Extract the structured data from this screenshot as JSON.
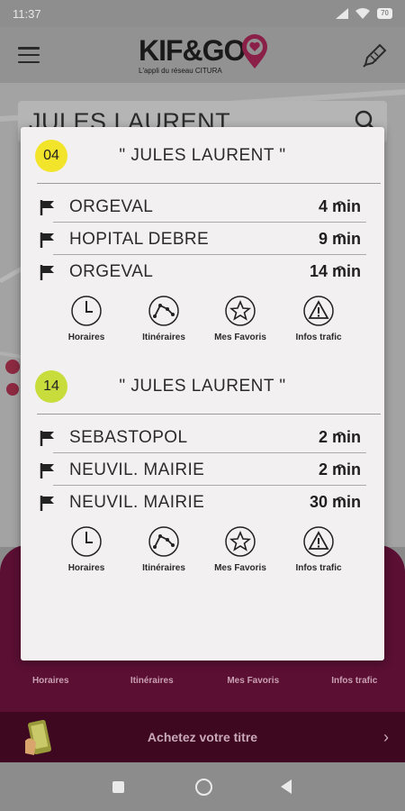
{
  "status_bar": {
    "time": "11:37",
    "battery": "70"
  },
  "header": {
    "logo_text": "KIF&GO",
    "tagline": "L'appli du réseau CITURA"
  },
  "search": {
    "value": "JULES LAURENT"
  },
  "dialog": {
    "sections": [
      {
        "line": "04",
        "line_color": "#f2e42a",
        "stop_name": "\" JULES LAURENT \"",
        "departures": [
          {
            "destination": "ORGEVAL",
            "wait": "4 min"
          },
          {
            "destination": "HOPITAL DEBRE",
            "wait": "9 min"
          },
          {
            "destination": "ORGEVAL",
            "wait": "14 min"
          }
        ],
        "actions": [
          "Horaires",
          "Itinéraires",
          "Mes Favoris",
          "Infos trafic"
        ]
      },
      {
        "line": "14",
        "line_color": "#c8dc3c",
        "stop_name": "\" JULES LAURENT \"",
        "departures": [
          {
            "destination": "SEBASTOPOL",
            "wait": "2 min"
          },
          {
            "destination": "NEUVIL. MAIRIE",
            "wait": "2 min"
          },
          {
            "destination": "NEUVIL. MAIRIE",
            "wait": "30 min"
          }
        ],
        "actions": [
          "Horaires",
          "Itinéraires",
          "Mes Favoris",
          "Infos trafic"
        ]
      }
    ]
  },
  "bottom_nav": {
    "items": [
      "Horaires",
      "Itinéraires",
      "Mes Favoris",
      "Infos trafic"
    ]
  },
  "buy_bar": {
    "label": "Achetez votre titre"
  },
  "colors": {
    "brand": "#5a0f33",
    "accent": "#d4145a"
  }
}
